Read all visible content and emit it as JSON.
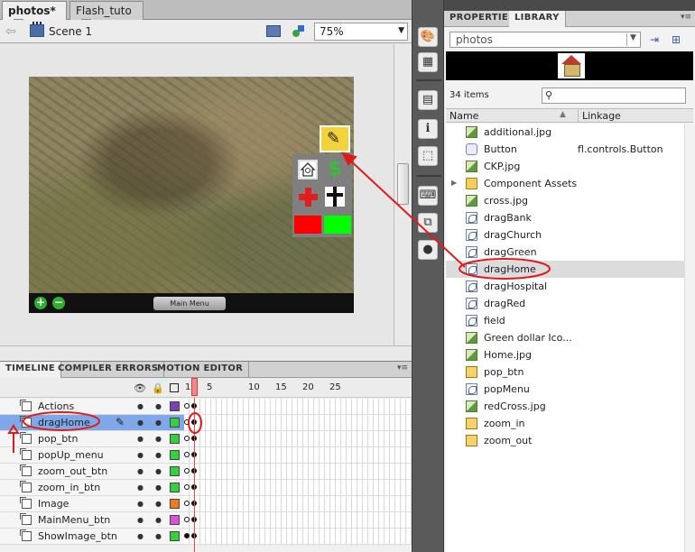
{
  "doc_tabs": [
    {
      "label": "photos*",
      "close": "x"
    },
    {
      "label": "Flash_tuto",
      "close": "x"
    }
  ],
  "scene": {
    "label": "Scene 1",
    "back_arrow": "⇦",
    "zoom": "75%",
    "dropdown": "▼"
  },
  "stage": {
    "zoom_in_symbol": "+",
    "zoom_out_symbol": "−",
    "main_menu_label": "Main Menu"
  },
  "timeline": {
    "tabs": [
      "TIMELINE",
      "COMPILER ERRORS",
      "MOTION EDITOR"
    ],
    "menu": "▾≡",
    "frame_numbers": [
      "1",
      "5",
      "10",
      "15",
      "20",
      "25"
    ],
    "eye_icon": "👁",
    "lock_icon": "🔒",
    "layers": [
      {
        "name": "Actions",
        "color": "#7b3fb0",
        "selected": false
      },
      {
        "name": "dragHome",
        "color": "#36d03f",
        "selected": true
      },
      {
        "name": "pop_btn",
        "color": "#36d03f",
        "selected": false
      },
      {
        "name": "popUp_menu",
        "color": "#36d03f",
        "selected": false
      },
      {
        "name": "zoom_out_btn",
        "color": "#36d03f",
        "selected": false
      },
      {
        "name": "zoom_in_btn",
        "color": "#36d03f",
        "selected": false
      },
      {
        "name": "Image",
        "color": "#f07b1e",
        "selected": false
      },
      {
        "name": "MainMenu_btn",
        "color": "#e04fd6",
        "selected": false
      },
      {
        "name": "ShowImage_btn",
        "color": "#36d03f",
        "selected": false
      }
    ]
  },
  "library": {
    "tabs": [
      "PROPERTIES",
      "LIBRARY"
    ],
    "menu": "▾≡",
    "document": "photos",
    "items_count": "34 items",
    "columns": {
      "name": "Name",
      "linkage": "Linkage"
    },
    "items": [
      {
        "name": "additional.jpg",
        "linkage": "",
        "icon": "bitmap-icon"
      },
      {
        "name": "Button",
        "linkage": "fl.controls.Button",
        "icon": "component-icon"
      },
      {
        "name": "CKP.jpg",
        "linkage": "",
        "icon": "bitmap-icon"
      },
      {
        "name": "Component Assets",
        "linkage": "",
        "icon": "folder-icon"
      },
      {
        "name": "cross.jpg",
        "linkage": "",
        "icon": "bitmap-icon"
      },
      {
        "name": "dragBank",
        "linkage": "",
        "icon": "graphic-icon"
      },
      {
        "name": "dragChurch",
        "linkage": "",
        "icon": "graphic-icon"
      },
      {
        "name": "dragGreen",
        "linkage": "",
        "icon": "graphic-icon"
      },
      {
        "name": "dragHome",
        "linkage": "",
        "icon": "graphic-icon"
      },
      {
        "name": "dragHospital",
        "linkage": "",
        "icon": "graphic-icon"
      },
      {
        "name": "dragRed",
        "linkage": "",
        "icon": "graphic-icon"
      },
      {
        "name": "field",
        "linkage": "",
        "icon": "graphic-icon"
      },
      {
        "name": "Green dollar Ico...",
        "linkage": "",
        "icon": "bitmap-icon"
      },
      {
        "name": "Home.jpg",
        "linkage": "",
        "icon": "bitmap-icon"
      },
      {
        "name": "pop_btn",
        "linkage": "",
        "icon": "button-icon"
      },
      {
        "name": "popMenu",
        "linkage": "",
        "icon": "graphic-icon"
      },
      {
        "name": "redCross.jpg",
        "linkage": "",
        "icon": "bitmap-icon"
      },
      {
        "name": "zoom_in",
        "linkage": "",
        "icon": "button-icon"
      },
      {
        "name": "zoom_out",
        "linkage": "",
        "icon": "button-icon"
      }
    ]
  },
  "colors": {
    "annotation_red": "#e01b1b",
    "selection_blue": "#7fa8e8"
  }
}
